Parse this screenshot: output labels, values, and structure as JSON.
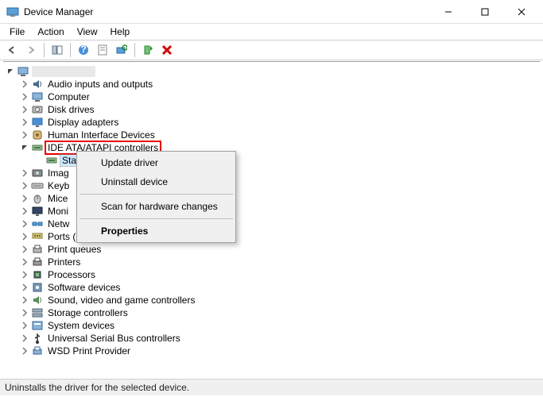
{
  "window": {
    "title": "Device Manager"
  },
  "menu": {
    "file": "File",
    "action": "Action",
    "view": "View",
    "help": "Help"
  },
  "tree": {
    "root": "",
    "items": [
      {
        "icon": "audio-icon",
        "label": "Audio inputs and outputs",
        "expanded": false
      },
      {
        "icon": "computer-icon",
        "label": "Computer",
        "expanded": false
      },
      {
        "icon": "disk-icon",
        "label": "Disk drives",
        "expanded": false
      },
      {
        "icon": "display-icon",
        "label": "Display adapters",
        "expanded": false
      },
      {
        "icon": "hid-icon",
        "label": "Human Interface Devices",
        "expanded": false
      },
      {
        "icon": "ide-icon",
        "label": "IDE ATA/ATAPI controllers",
        "expanded": true,
        "highlighted": true,
        "children": [
          {
            "icon": "ide-icon",
            "label": "Standard SATA AHCI Controller",
            "selected": true
          }
        ]
      },
      {
        "icon": "imaging-icon",
        "label": "Imag",
        "expanded": false
      },
      {
        "icon": "keyboard-icon",
        "label": "Keyb",
        "expanded": false
      },
      {
        "icon": "mouse-icon",
        "label": "Mice",
        "expanded": false
      },
      {
        "icon": "monitor-icon",
        "label": "Moni",
        "expanded": false
      },
      {
        "icon": "network-icon",
        "label": "Netw",
        "expanded": false
      },
      {
        "icon": "ports-icon",
        "label": "Ports (COM & LPT)",
        "expanded": false
      },
      {
        "icon": "printqueue-icon",
        "label": "Print queues",
        "expanded": false
      },
      {
        "icon": "printer-icon",
        "label": "Printers",
        "expanded": false
      },
      {
        "icon": "processor-icon",
        "label": "Processors",
        "expanded": false
      },
      {
        "icon": "software-icon",
        "label": "Software devices",
        "expanded": false
      },
      {
        "icon": "sound-icon",
        "label": "Sound, video and game controllers",
        "expanded": false
      },
      {
        "icon": "storage-icon",
        "label": "Storage controllers",
        "expanded": false
      },
      {
        "icon": "system-icon",
        "label": "System devices",
        "expanded": false
      },
      {
        "icon": "usb-icon",
        "label": "Universal Serial Bus controllers",
        "expanded": false
      },
      {
        "icon": "wsd-icon",
        "label": "WSD Print Provider",
        "expanded": false
      }
    ]
  },
  "context_menu": {
    "update": "Update driver",
    "uninstall": "Uninstall device",
    "scan": "Scan for hardware changes",
    "properties": "Properties"
  },
  "statusbar": "Uninstalls the driver for the selected device."
}
